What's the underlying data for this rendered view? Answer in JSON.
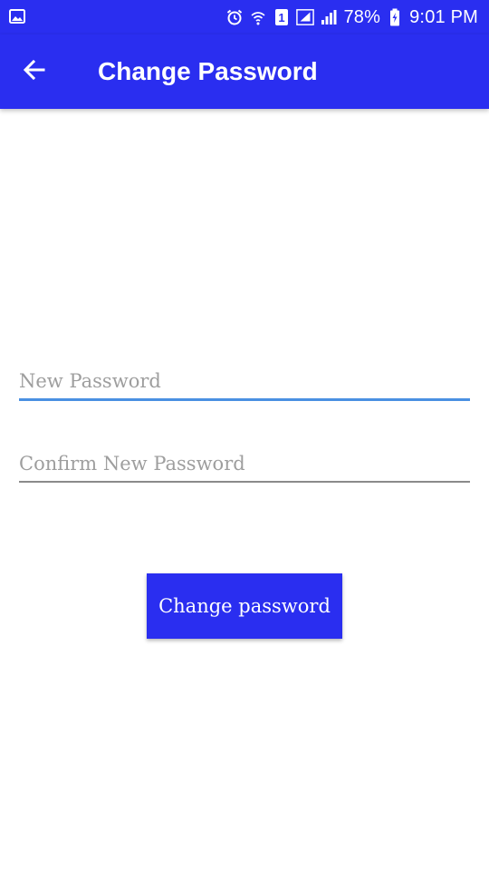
{
  "status_bar": {
    "battery_percent": "78%",
    "time": "9:01 PM",
    "sim_badge": "1",
    "icons": [
      "image-notification-icon",
      "alarm-icon",
      "wifi-icon",
      "sim-1-icon",
      "signal-icon",
      "signal-icon-2",
      "battery-charging-icon"
    ]
  },
  "app_bar": {
    "title": "Change Password",
    "back_icon": "arrow-left-icon"
  },
  "form": {
    "new_password": {
      "placeholder": "New Password",
      "value": ""
    },
    "confirm_password": {
      "placeholder": "Confirm New Password",
      "value": ""
    },
    "submit_label": "Change password"
  },
  "colors": {
    "primary": "#2a2ef0",
    "focused_underline": "#4a90e2",
    "underline": "#8a8a8a",
    "placeholder": "#9e9e9e"
  }
}
